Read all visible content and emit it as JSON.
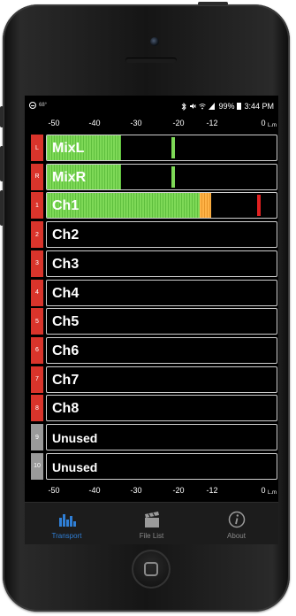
{
  "status_bar": {
    "left_icon": "circle-minus-icon",
    "left_small_text": "68°",
    "right_icons": [
      "bluetooth-icon",
      "mute-icon",
      "wifi-icon",
      "signal-icon"
    ],
    "battery_percent": "99%",
    "battery_icon": "battery-icon",
    "time": "3:44 PM"
  },
  "scale": {
    "ticks": [
      "-50",
      "-40",
      "-30",
      "-20",
      "-12",
      "0"
    ],
    "unit_label": "L.m"
  },
  "channels": [
    {
      "num": "L",
      "name": "MixL",
      "badge_color": "#d9342b",
      "level": 0.32,
      "peak": 0.54,
      "peak_color": "#7ed957",
      "orange": 0
    },
    {
      "num": "R",
      "name": "MixR",
      "badge_color": "#d9342b",
      "level": 0.32,
      "peak": 0.54,
      "peak_color": "#7ed957",
      "orange": 0
    },
    {
      "num": "1",
      "name": "Ch1",
      "badge_color": "#d9342b",
      "level": 0.66,
      "peak": 0.91,
      "peak_color": "#e02020",
      "orange": 0.05
    },
    {
      "num": "2",
      "name": "Ch2",
      "badge_color": "#d9342b",
      "level": 0,
      "peak": null,
      "peak_color": "",
      "orange": 0
    },
    {
      "num": "3",
      "name": "Ch3",
      "badge_color": "#d9342b",
      "level": 0,
      "peak": null,
      "peak_color": "",
      "orange": 0
    },
    {
      "num": "4",
      "name": "Ch4",
      "badge_color": "#d9342b",
      "level": 0,
      "peak": null,
      "peak_color": "",
      "orange": 0
    },
    {
      "num": "5",
      "name": "Ch5",
      "badge_color": "#d9342b",
      "level": 0,
      "peak": null,
      "peak_color": "",
      "orange": 0
    },
    {
      "num": "6",
      "name": "Ch6",
      "badge_color": "#d9342b",
      "level": 0,
      "peak": null,
      "peak_color": "",
      "orange": 0
    },
    {
      "num": "7",
      "name": "Ch7",
      "badge_color": "#d9342b",
      "level": 0,
      "peak": null,
      "peak_color": "",
      "orange": 0
    },
    {
      "num": "8",
      "name": "Ch8",
      "badge_color": "#d9342b",
      "level": 0,
      "peak": null,
      "peak_color": "",
      "orange": 0
    },
    {
      "num": "9",
      "name": "Unused",
      "badge_color": "#9a9a9a",
      "level": 0,
      "peak": null,
      "peak_color": "",
      "orange": 0
    },
    {
      "num": "10",
      "name": "Unused",
      "badge_color": "#9a9a9a",
      "level": 0,
      "peak": null,
      "peak_color": "",
      "orange": 0
    }
  ],
  "tabs": [
    {
      "label": "Transport",
      "icon": "transport-meter-icon",
      "active": true
    },
    {
      "label": "File List",
      "icon": "clapperboard-icon",
      "active": false
    },
    {
      "label": "About",
      "icon": "info-icon",
      "active": false
    }
  ],
  "colors": {
    "accent": "#2f7fd6",
    "meter_green": "#7ed957",
    "clip_red": "#e02020",
    "badge_red": "#d9342b",
    "badge_gray": "#9a9a9a"
  }
}
